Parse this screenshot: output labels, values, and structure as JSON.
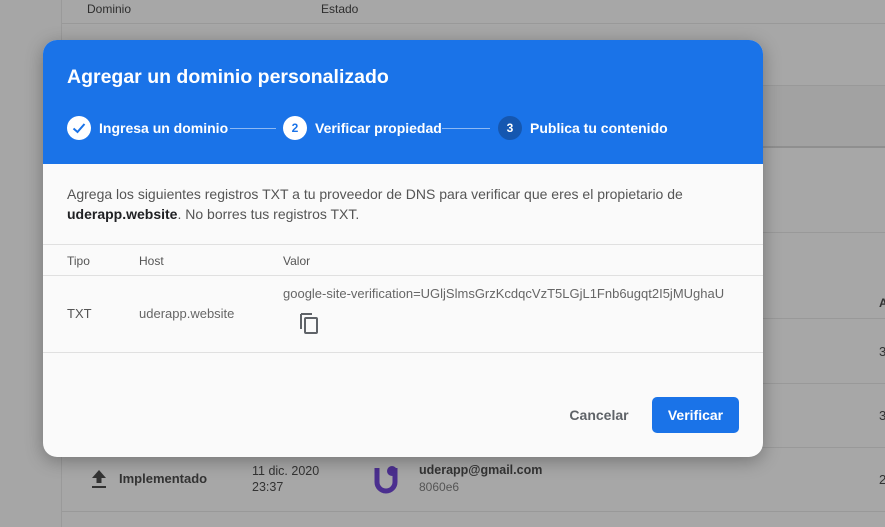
{
  "background": {
    "table_headers": {
      "domain": "Dominio",
      "status": "Estado"
    },
    "right_col_letter": "A",
    "right_col_numbers": [
      "3",
      "3",
      "2"
    ],
    "release_row": {
      "status": "Implementado",
      "date_line1": "11 dic. 2020",
      "date_line2": "23:37",
      "email": "uderapp@gmail.com",
      "hash": "8060e6"
    }
  },
  "modal": {
    "title": "Agregar un dominio personalizado",
    "steps": [
      {
        "number": "1",
        "label": "Ingresa un dominio",
        "state": "done"
      },
      {
        "number": "2",
        "label": "Verificar propiedad",
        "state": "active"
      },
      {
        "number": "3",
        "label": "Publica tu contenido",
        "state": "pending"
      }
    ],
    "description_part1": "Agrega los siguientes registros TXT a tu proveedor de DNS para verificar que eres el propietario de",
    "description_domain": "uderapp.website",
    "description_part2": ". No borres tus registros TXT.",
    "table": {
      "headers": {
        "type": "Tipo",
        "host": "Host",
        "value": "Valor"
      },
      "row": {
        "type": "TXT",
        "host": "uderapp.website",
        "value": "google-site-verification=UGljSlmsGrzKcdqcVzT5LGjL1Fnb6ugqt2I5jMUghaU"
      }
    },
    "buttons": {
      "cancel": "Cancelar",
      "verify": "Verificar"
    },
    "colors": {
      "primary": "#1a73e8",
      "header_bg": "#1a73e8",
      "pending_step": "#1557b0"
    }
  }
}
